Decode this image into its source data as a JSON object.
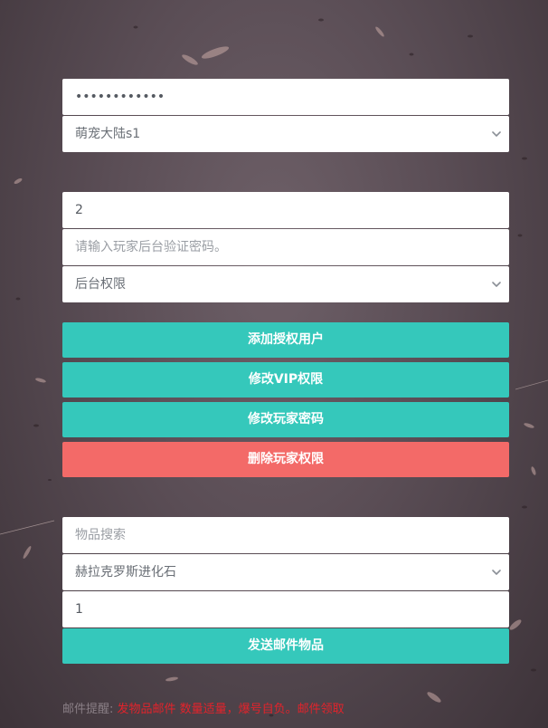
{
  "account": {
    "password_value": "••••••••••••",
    "server_selected": "萌宠大陆s1"
  },
  "player": {
    "id_value": "2",
    "verify_password_placeholder": "请输入玩家后台验证密码。",
    "permission_selected": "后台权限"
  },
  "actions": {
    "add_auth_user": "添加授权用户",
    "modify_vip": "修改VIP权限",
    "modify_player_password": "修改玩家密码",
    "delete_player_permission": "删除玩家权限"
  },
  "mail": {
    "item_search_placeholder": "物品搜索",
    "item_selected": "赫拉克罗斯进化石",
    "quantity_value": "1",
    "send_button": "发送邮件物品"
  },
  "notice": {
    "label": "邮件提醒:",
    "message": "发物品邮件 数量适量，爆号自负。邮件领取"
  },
  "colors": {
    "accent": "#35c8bb",
    "danger": "#f36a68",
    "notice": "#e2232b"
  }
}
